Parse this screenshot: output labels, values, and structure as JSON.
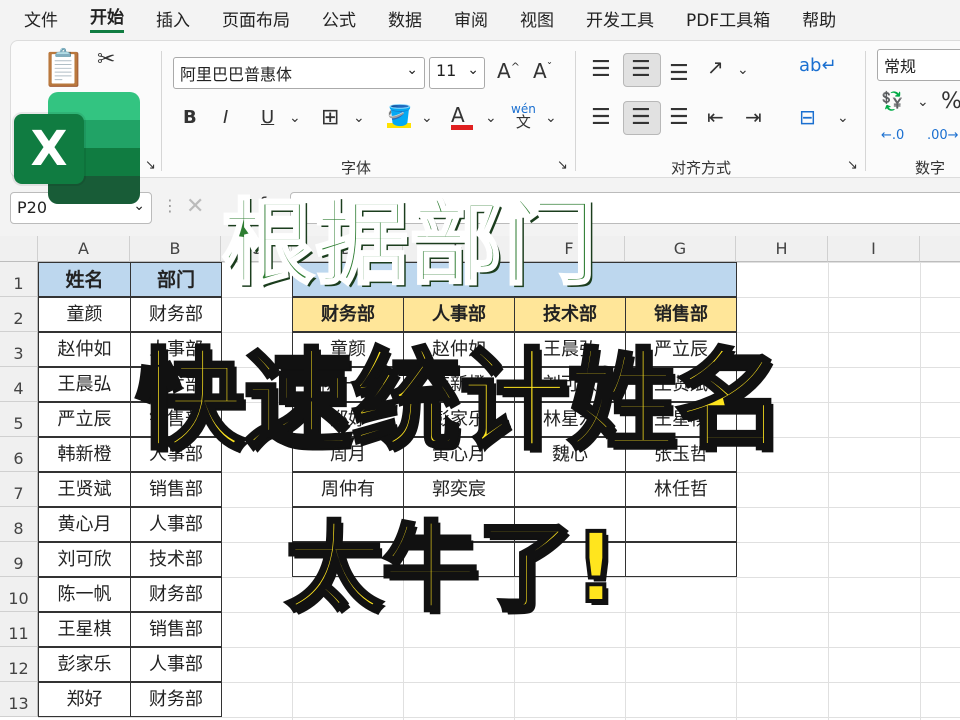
{
  "menu": [
    "文件",
    "开始",
    "插入",
    "页面布局",
    "公式",
    "数据",
    "审阅",
    "视图",
    "开发工具",
    "PDF工具箱",
    "帮助"
  ],
  "ribbon": {
    "font_name": "阿里巴巴普惠体",
    "font_size": "11",
    "number_format": "常规",
    "group_font": "字体",
    "group_align": "对齐方式",
    "group_number": "数字",
    "bold": "B",
    "italic": "I",
    "underline": "U",
    "grow_font": "A",
    "shrink_font": "A",
    "font_color": "A",
    "phonetic": "文"
  },
  "formula_bar": {
    "name_box": "P20",
    "fx": "fx"
  },
  "columns": [
    "A",
    "B",
    "C",
    "D",
    "E",
    "F",
    "G",
    "H",
    "I"
  ],
  "rows": [
    "1",
    "2",
    "3",
    "4",
    "5",
    "6",
    "7",
    "8",
    "9",
    "10",
    "11",
    "12",
    "13"
  ],
  "left_table": {
    "headers": [
      "姓名",
      "部门"
    ],
    "rows": [
      [
        "童颜",
        "财务部"
      ],
      [
        "赵仲如",
        "人事部"
      ],
      [
        "王晨弘",
        "技术部"
      ],
      [
        "严立辰",
        "销售部"
      ],
      [
        "韩新橙",
        "人事部"
      ],
      [
        "王贤斌",
        "销售部"
      ],
      [
        "黄心月",
        "人事部"
      ],
      [
        "刘可欣",
        "技术部"
      ],
      [
        "陈一帆",
        "财务部"
      ],
      [
        "王星棋",
        "销售部"
      ],
      [
        "彭家乐",
        "人事部"
      ],
      [
        "郑好",
        "财务部"
      ]
    ]
  },
  "right_table": {
    "headers": [
      "财务部",
      "人事部",
      "技术部",
      "销售部"
    ],
    "rows": [
      [
        "童颜",
        "赵仲如",
        "王晨弘",
        "严立辰"
      ],
      [
        "陈一帆",
        "韩新橙",
        "刘可欣",
        "王贤斌"
      ],
      [
        "郑好",
        "彭家乐",
        "林星宏",
        "王星棋"
      ],
      [
        "周月",
        "黄心月",
        "魏心",
        "张玉哲"
      ],
      [
        "周仲有",
        "郭奕宸",
        "",
        "林任哲"
      ],
      [
        "",
        "",
        "",
        ""
      ]
    ]
  },
  "overlay": {
    "line1": "根据部门",
    "line2": "快速统计姓名",
    "line3": "太牛了!"
  },
  "colors": {
    "excel_green": "#107c41",
    "overlay_green": "#2e7d32",
    "overlay_yellow": "#ffe51e",
    "header_blue": "#bdd7ee",
    "header_yellow": "#ffe699"
  }
}
